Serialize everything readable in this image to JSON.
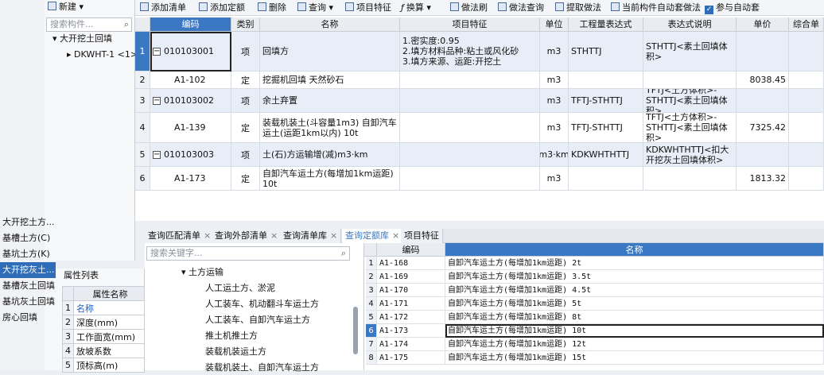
{
  "left_nav": {
    "items": [
      "大开挖土方...",
      "基槽土方(C)",
      "基坑土方(K)",
      "大开挖灰土...",
      "基槽灰土回填",
      "基坑灰土回填",
      "房心回填"
    ],
    "active_index": 3
  },
  "tree_panel": {
    "new_label": "新建",
    "search_placeholder": "搜索构件...",
    "root_label": "大开挖土回填",
    "child_label": "DKWHT-1 <1>"
  },
  "property_panel": {
    "title": "属性列表",
    "header": "属性名称",
    "rows": [
      {
        "n": "1",
        "name": "名称"
      },
      {
        "n": "2",
        "name": "深度(mm)"
      },
      {
        "n": "3",
        "name": "工作面宽(mm)"
      },
      {
        "n": "4",
        "name": "放坡系数"
      },
      {
        "n": "5",
        "name": "顶标高(m)"
      }
    ]
  },
  "toolbar": {
    "add_list": "添加清单",
    "add_quota": "添加定额",
    "delete": "删除",
    "query": "查询",
    "item_feature": "项目特征",
    "convert": "换算",
    "brush": "做法刷",
    "method_query": "做法查询",
    "extract": "提取做法",
    "auto_apply_current": "当前构件自动套做法",
    "join_auto": "参与自动套"
  },
  "main_grid": {
    "headers": [
      "编码",
      "类别",
      "名称",
      "项目特征",
      "单位",
      "工程量表达式",
      "表达式说明",
      "单价",
      "综合单"
    ],
    "rows": [
      {
        "n": "1",
        "code": "010103001",
        "cat": "项",
        "name": "回填方",
        "feature": [
          "1.密实度:0.95",
          "2.填方材料品种:粘土或风化砂",
          "3.填方来源、运距:开挖土"
        ],
        "unit": "m3",
        "expr": "STHTTJ",
        "desc": "STHTTJ<素土回填体积>",
        "price": ""
      },
      {
        "n": "2",
        "code": "A1-102",
        "cat": "定",
        "name": "挖掘机回填 天然砂石",
        "feature": [],
        "unit": "m3",
        "expr": "",
        "desc": "",
        "price": "8038.45"
      },
      {
        "n": "3",
        "code": "010103002",
        "cat": "项",
        "name": "余土弃置",
        "feature": [],
        "unit": "m3",
        "expr": "TFTJ-STHTTJ",
        "desc": "TFTJ<土方体积>-STHTTJ<素土回填体积>",
        "price": ""
      },
      {
        "n": "4",
        "code": "A1-139",
        "cat": "定",
        "name": "装载机装土(斗容量1m3) 自卸汽车运土(运距1km以内) 10t",
        "feature": [],
        "unit": "m3",
        "expr": "TFTJ-STHTTJ",
        "desc": "TFTJ<土方体积>-STHTTJ<素土回填体积>",
        "price": "7325.42"
      },
      {
        "n": "5",
        "code": "010103003",
        "cat": "项",
        "name": "土(石)方运输增(减)m3·km",
        "feature": [],
        "unit": "m3·km",
        "expr": "KDKWHTHTTJ",
        "desc": "KDKWHTHTTJ<扣大开挖灰土回填体积>",
        "price": ""
      },
      {
        "n": "6",
        "code": "A1-173",
        "cat": "定",
        "name": "自卸汽车运土方(每增加1km运距) 10t",
        "feature": [],
        "unit": "m3",
        "expr": "",
        "desc": "",
        "price": "1813.32"
      }
    ]
  },
  "tabs": [
    {
      "label": "查询匹配清单",
      "active": false
    },
    {
      "label": "查询外部清单",
      "active": false
    },
    {
      "label": "查询清单库",
      "active": false
    },
    {
      "label": "查询定额库",
      "active": true
    },
    {
      "label": "项目特征",
      "active": false
    }
  ],
  "lib_tree": {
    "search_placeholder": "搜索关键字...",
    "group_label": "土方运输",
    "items": [
      "人工运土方、淤泥",
      "人工装车、机动翻斗车运土方",
      "人工装车、自卸汽车运土方",
      "推土机推土方",
      "装载机装运土方",
      "装载机装土、自卸汽车运土方"
    ]
  },
  "lib_grid": {
    "headers": [
      "编码",
      "名称"
    ],
    "selected_index": 5,
    "rows": [
      {
        "n": "1",
        "code": "A1-168",
        "name": "自卸汽车运土方(每增加1km运距) 2t"
      },
      {
        "n": "2",
        "code": "A1-169",
        "name": "自卸汽车运土方(每增加1km运距) 3.5t"
      },
      {
        "n": "3",
        "code": "A1-170",
        "name": "自卸汽车运土方(每增加1km运距) 4.5t"
      },
      {
        "n": "4",
        "code": "A1-171",
        "name": "自卸汽车运土方(每增加1km运距) 5t"
      },
      {
        "n": "5",
        "code": "A1-172",
        "name": "自卸汽车运土方(每增加1km运距) 8t"
      },
      {
        "n": "6",
        "code": "A1-173",
        "name": "自卸汽车运土方(每增加1km运距) 10t"
      },
      {
        "n": "7",
        "code": "A1-174",
        "name": "自卸汽车运土方(每增加1km运距) 12t"
      },
      {
        "n": "8",
        "code": "A1-175",
        "name": "自卸汽车运土方(每增加1km运距) 15t"
      }
    ]
  }
}
